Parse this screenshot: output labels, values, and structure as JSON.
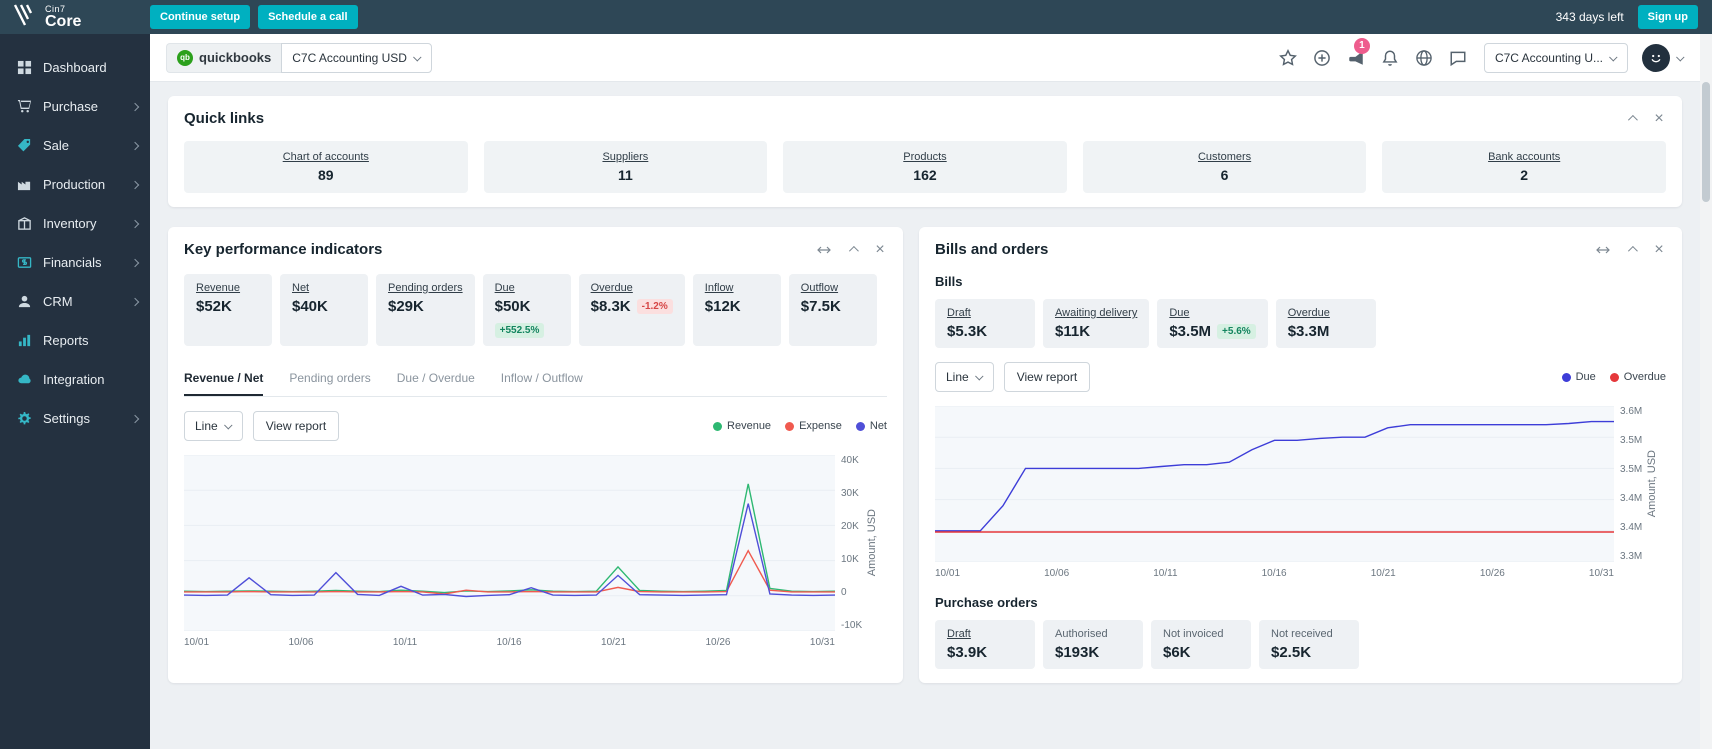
{
  "topbar": {
    "logo_brand": "Cin7",
    "logo_product": "Core",
    "continue_setup": "Continue setup",
    "schedule_call": "Schedule a call",
    "days_left": "343 days left",
    "sign_up": "Sign up"
  },
  "sidebar": {
    "items": [
      {
        "label": "Dashboard"
      },
      {
        "label": "Purchase"
      },
      {
        "label": "Sale"
      },
      {
        "label": "Production"
      },
      {
        "label": "Inventory"
      },
      {
        "label": "Financials"
      },
      {
        "label": "CRM"
      },
      {
        "label": "Reports"
      },
      {
        "label": "Integration"
      },
      {
        "label": "Settings"
      }
    ]
  },
  "header": {
    "quickbooks_label": "quickbooks",
    "company_select": "C7C Accounting USD",
    "account_select": "C7C Accounting U...",
    "notification_count": "1"
  },
  "quick_links": {
    "title": "Quick links",
    "items": [
      {
        "label": "Chart of accounts",
        "value": "89"
      },
      {
        "label": "Suppliers",
        "value": "11"
      },
      {
        "label": "Products",
        "value": "162"
      },
      {
        "label": "Customers",
        "value": "6"
      },
      {
        "label": "Bank accounts",
        "value": "2"
      }
    ]
  },
  "kpi": {
    "title": "Key performance indicators",
    "tiles": [
      {
        "label": "Revenue",
        "value": "$52K"
      },
      {
        "label": "Net",
        "value": "$40K"
      },
      {
        "label": "Pending orders",
        "value": "$29K"
      },
      {
        "label": "Due",
        "value": "$50K",
        "badge": "+552.5%"
      },
      {
        "label": "Overdue",
        "value": "$8.3K",
        "badge": "-1.2%"
      },
      {
        "label": "Inflow",
        "value": "$12K"
      },
      {
        "label": "Outflow",
        "value": "$7.5K"
      }
    ],
    "tabs": [
      {
        "label": "Revenue / Net"
      },
      {
        "label": "Pending orders"
      },
      {
        "label": "Due / Overdue"
      },
      {
        "label": "Inflow / Outflow"
      }
    ],
    "chart_type": "Line",
    "view_report": "View report",
    "legend": [
      {
        "label": "Revenue",
        "color": "#2eb872"
      },
      {
        "label": "Expense",
        "color": "#f05a4f"
      },
      {
        "label": "Net",
        "color": "#4f4fd8"
      }
    ]
  },
  "bills": {
    "title": "Bills and orders",
    "bills_heading": "Bills",
    "tiles": [
      {
        "label": "Draft",
        "value": "$5.3K"
      },
      {
        "label": "Awaiting delivery",
        "value": "$11K"
      },
      {
        "label": "Due",
        "value": "$3.5M",
        "badge": "+5.6%"
      },
      {
        "label": "Overdue",
        "value": "$3.3M"
      }
    ],
    "chart_type": "Line",
    "view_report": "View report",
    "legend": [
      {
        "label": "Due",
        "color": "#3d3dd8"
      },
      {
        "label": "Overdue",
        "color": "#e5383b"
      }
    ],
    "po_heading": "Purchase orders",
    "po_tiles": [
      {
        "label": "Draft",
        "value": "$3.9K"
      },
      {
        "label": "Authorised",
        "value": "$193K"
      },
      {
        "label": "Not invoiced",
        "value": "$6K"
      },
      {
        "label": "Not received",
        "value": "$2.5K"
      }
    ]
  },
  "chart_data": [
    {
      "id": "kpi-revenue-net",
      "type": "line",
      "title": "Revenue / Net",
      "ylabel": "Amount, USD",
      "ylim": [
        -10,
        40
      ],
      "yticks": [
        "40K",
        "30K",
        "20K",
        "10K",
        "0",
        "-10K"
      ],
      "xticks": [
        "10/01",
        "10/06",
        "10/11",
        "10/16",
        "10/21",
        "10/26",
        "10/31"
      ],
      "units": "thousand USD",
      "series": [
        {
          "name": "Revenue",
          "color": "#2eb872",
          "values": [
            1.3,
            1.2,
            1.3,
            1.4,
            1.3,
            1.2,
            1.3,
            1.5,
            1.3,
            1.2,
            1.6,
            1.3,
            0.9,
            1.4,
            1.2,
            1.4,
            1.7,
            1.3,
            1.2,
            1.3,
            8.2,
            1.5,
            1.3,
            1.2,
            1.3,
            1.5,
            31.8,
            2.1,
            1.3,
            1.2,
            1.3
          ]
        },
        {
          "name": "Expense",
          "color": "#f05a4f",
          "values": [
            1.1,
            1.1,
            1.1,
            1.2,
            1.1,
            1.1,
            1.1,
            1.2,
            1.1,
            1.1,
            1.2,
            1.1,
            0.5,
            1.6,
            1.1,
            1.1,
            1.2,
            1.1,
            1.1,
            1.1,
            2.4,
            1.2,
            1.1,
            1.1,
            1.1,
            1.2,
            12.8,
            1.6,
            1.1,
            1.1,
            1.1
          ]
        },
        {
          "name": "Net",
          "color": "#4f4fd8",
          "values": [
            0.2,
            0.1,
            0.2,
            5.1,
            0.3,
            0.1,
            0.2,
            6.6,
            0.4,
            0.1,
            2.7,
            0.2,
            0.4,
            -0.2,
            0.1,
            0.3,
            2.3,
            0.2,
            0.1,
            0.2,
            5.8,
            0.3,
            0.2,
            0.1,
            0.2,
            0.3,
            26.2,
            0.5,
            0.2,
            0.1,
            0.2
          ]
        }
      ]
    },
    {
      "id": "bills-due-overdue",
      "type": "line",
      "title": "Bills",
      "ylabel": "Amount, USD",
      "ylim": [
        3.35,
        3.6
      ],
      "yticks": [
        "3.6M",
        "3.5M",
        "3.5M",
        "3.4M",
        "3.4M",
        "3.3M"
      ],
      "xticks": [
        "10/01",
        "10/06",
        "10/11",
        "10/16",
        "10/21",
        "10/26",
        "10/31"
      ],
      "units": "million USD",
      "series": [
        {
          "name": "Due",
          "color": "#3d3dd8",
          "values": [
            3.4,
            3.4,
            3.4,
            3.44,
            3.5,
            3.5,
            3.5,
            3.5,
            3.5,
            3.5,
            3.503,
            3.506,
            3.506,
            3.51,
            3.53,
            3.545,
            3.545,
            3.548,
            3.55,
            3.55,
            3.565,
            3.57,
            3.57,
            3.57,
            3.57,
            3.57,
            3.57,
            3.57,
            3.572,
            3.575,
            3.575
          ]
        },
        {
          "name": "Overdue",
          "color": "#e5383b",
          "values": [
            3.398,
            3.398,
            3.398,
            3.398,
            3.398,
            3.398,
            3.398,
            3.398,
            3.398,
            3.398,
            3.398,
            3.398,
            3.398,
            3.398,
            3.398,
            3.398,
            3.398,
            3.398,
            3.398,
            3.398,
            3.398,
            3.398,
            3.398,
            3.398,
            3.398,
            3.398,
            3.398,
            3.398,
            3.398,
            3.398,
            3.398
          ]
        }
      ]
    }
  ]
}
